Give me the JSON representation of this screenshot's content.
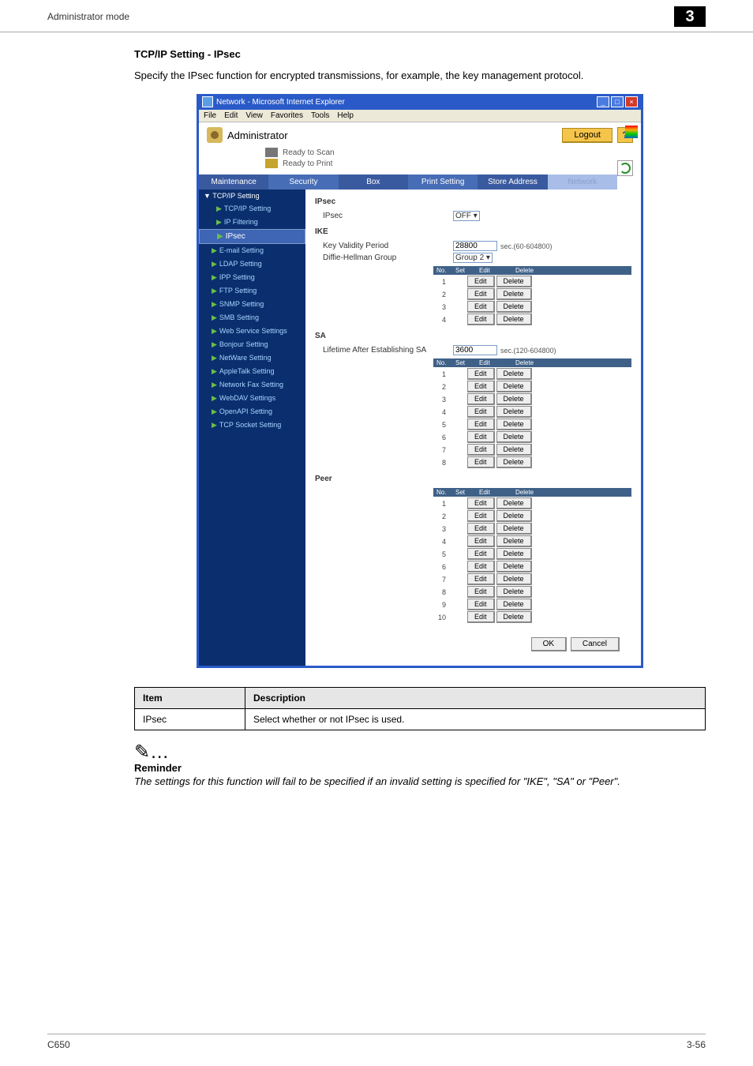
{
  "doc": {
    "header_title": "Administrator mode",
    "page_chapter": "3",
    "section_title": "TCP/IP Setting - IPsec",
    "section_body": "Specify the IPsec function for encrypted transmissions, for example, the key management protocol.",
    "reminder_label": "Reminder",
    "reminder_body": "The settings for this function will fail to be specified if an invalid setting is specified for \"IKE\", \"SA\" or \"Peer\".",
    "footer_left": "C650",
    "footer_right": "3-56",
    "table_header_item": "Item",
    "table_header_desc": "Description",
    "table_row_item": "IPsec",
    "table_row_desc": "Select whether or not IPsec is used.",
    "note_glyph": "✎…"
  },
  "shot": {
    "window_title": "Network - Microsoft Internet Explorer",
    "menu": [
      "File",
      "Edit",
      "View",
      "Favorites",
      "Tools",
      "Help"
    ],
    "admin_label": "Administrator",
    "logout": "Logout",
    "help_glyph": "?",
    "status_scan": "Ready to Scan",
    "status_print": "Ready to Print",
    "tabs": [
      "Maintenance",
      "Security",
      "Box",
      "Print Setting",
      "Store Address",
      "Network"
    ],
    "side": {
      "header": "TCP/IP Setting",
      "items": [
        {
          "label": "TCP/IP Setting",
          "sub": true
        },
        {
          "label": "IP Filtering",
          "sub": true
        },
        {
          "label": "IPsec",
          "sub": true,
          "sel": true
        },
        {
          "label": "E-mail Setting"
        },
        {
          "label": "LDAP Setting"
        },
        {
          "label": "IPP Setting"
        },
        {
          "label": "FTP Setting"
        },
        {
          "label": "SNMP Setting"
        },
        {
          "label": "SMB Setting"
        },
        {
          "label": "Web Service Settings"
        },
        {
          "label": "Bonjour Setting"
        },
        {
          "label": "NetWare Setting"
        },
        {
          "label": "AppleTalk Setting"
        },
        {
          "label": "Network Fax Setting"
        },
        {
          "label": "WebDAV Settings"
        },
        {
          "label": "OpenAPI Setting"
        },
        {
          "label": "TCP Socket Setting"
        }
      ]
    },
    "main": {
      "ipsec_title": "IPsec",
      "ipsec_label": "IPsec",
      "ipsec_value": "OFF",
      "ike_title": "IKE",
      "key_validity_label": "Key Validity Period",
      "key_validity_value": "28800",
      "key_validity_hint": "sec.(60-604800)",
      "dh_label": "Diffie-Hellman Group",
      "dh_value": "Group 2",
      "sa_title": "SA",
      "sa_lifetime_label": "Lifetime After Establishing SA",
      "sa_lifetime_value": "3600",
      "sa_lifetime_hint": "sec.(120-604800)",
      "peer_title": "Peer",
      "col_no": "No.",
      "col_set": "Set",
      "col_edit": "Edit",
      "col_delete": "Delete",
      "edit_btn": "Edit",
      "delete_btn": "Delete",
      "ok_btn": "OK",
      "cancel_btn": "Cancel",
      "ike_rows": [
        1,
        2,
        3,
        4
      ],
      "sa_rows": [
        1,
        2,
        3,
        4,
        5,
        6,
        7,
        8
      ],
      "peer_rows": [
        1,
        2,
        3,
        4,
        5,
        6,
        7,
        8,
        9,
        10
      ]
    }
  }
}
